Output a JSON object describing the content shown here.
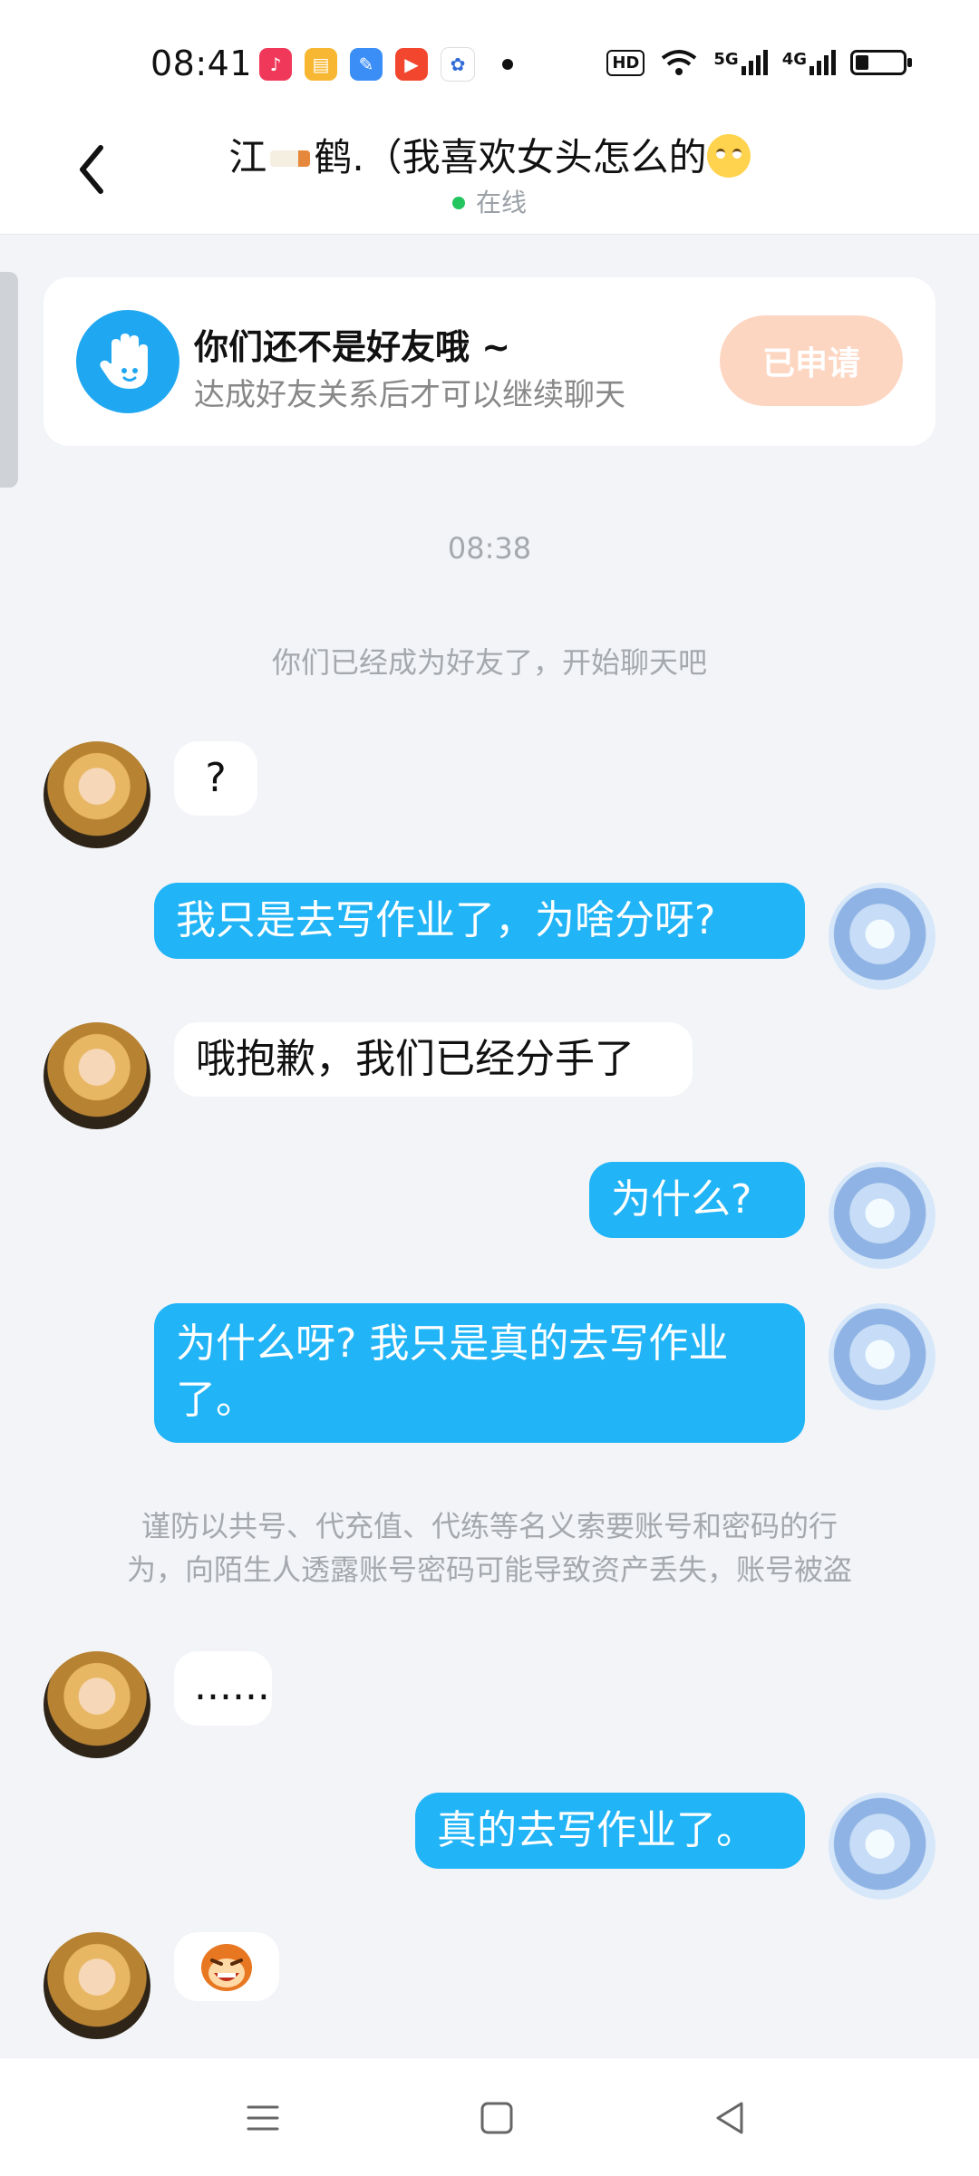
{
  "status_bar": {
    "time": "08:41",
    "app_icons": [
      "music-app-icon",
      "books-app-icon",
      "feather-app-icon",
      "video-app-icon",
      "baidu-app-icon"
    ],
    "hd_label": "HD",
    "signal1_label": "5G",
    "signal2_label": "4G"
  },
  "header": {
    "back_icon": "chevron-left-icon",
    "title_left": "江",
    "title_right": "鹤.（我喜欢女头怎么的",
    "online_label": "在线"
  },
  "friend_card": {
    "title": "你们还不是好友哦 ~",
    "subtitle": "达成好友关系后才可以继续聊天",
    "button_label": "已申请",
    "button_color": "#fdd6c2",
    "icon": "hand-wave-icon"
  },
  "chat": {
    "timestamp": "08:38",
    "system_message": "你们已经成为好友了，开始聊天吧",
    "warning_line1": "谨防以共号、代充值、代练等名义索要账号和密码的行",
    "warning_line2": "为，向陌生人透露账号密码可能导致资产丢失，账号被盗",
    "messages": [
      {
        "side": "in",
        "text": "?"
      },
      {
        "side": "out",
        "text": "我只是去写作业了，为啥分呀?"
      },
      {
        "side": "in",
        "text": "哦抱歉，我们已经分手了"
      },
      {
        "side": "out",
        "text": "为什么?"
      },
      {
        "side": "out",
        "text_line1": "为什么呀? 我只是真的去写作业",
        "text_line2": "了。"
      },
      {
        "side": "in",
        "text": "......"
      },
      {
        "side": "out",
        "text": "真的去写作业了。"
      },
      {
        "side": "in",
        "sticker": "laughing-monkey-sticker"
      }
    ],
    "accent_color": "#21b4f6"
  },
  "nav_bar": {
    "menu_icon": "menu-icon",
    "home_icon": "home-square-icon",
    "back_icon": "back-triangle-icon"
  }
}
